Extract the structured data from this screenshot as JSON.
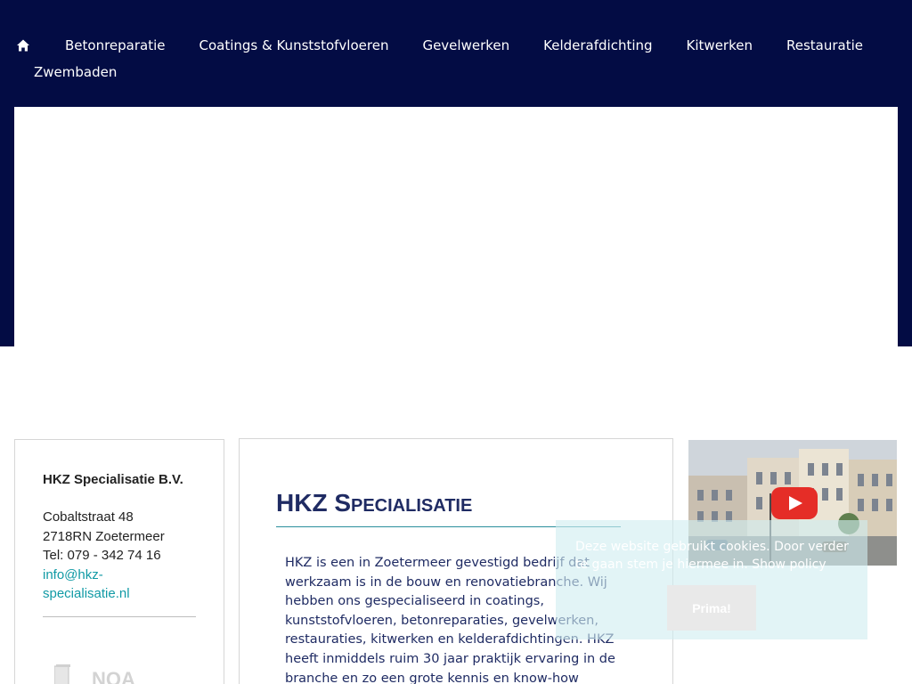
{
  "nav": {
    "home_icon": "home-icon",
    "items": [
      {
        "label": "Betonreparatie"
      },
      {
        "label": "Coatings & Kunststofvloeren"
      },
      {
        "label": "Gevelwerken"
      },
      {
        "label": "Kelderafdichting"
      },
      {
        "label": "Kitwerken"
      },
      {
        "label": "Restauratie"
      },
      {
        "label": "Zwembaden"
      }
    ]
  },
  "sidebar": {
    "company": "HKZ Specialisatie B.V.",
    "street": "Cobaltstraat 48",
    "city": "2718RN Zoetermeer",
    "phone": "Tel: 079 - 342 74 16",
    "email": "info@hkz-specialisatie.nl",
    "logo_text": "NQA"
  },
  "main": {
    "title": "HKZ Specialisatie",
    "intro": "HKZ is een in Zoetermeer gevestigd bedrijf dat werkzaam is in de bouw en renovatiebranche. Wij hebben ons gespecialiseerd in coatings, kunststofvloeren, betonreparaties, gevelwerken, restauraties, kitwerken en kelderafdichtingen. HKZ heeft inmiddels ruim 30 jaar praktijk ervaring in de branche en zo een grote kennis en know-how"
  },
  "cookie": {
    "text": "Deze website gebruikt cookies. Door verder te gaan stem je hiermee in. Show policy",
    "button": "Prima!"
  },
  "video": {
    "play_icon": "youtube-play-icon"
  },
  "colors": {
    "header_bg": "#030c44",
    "link": "#119aa5",
    "title": "#1f2b63",
    "youtube_red": "#e52d27"
  }
}
